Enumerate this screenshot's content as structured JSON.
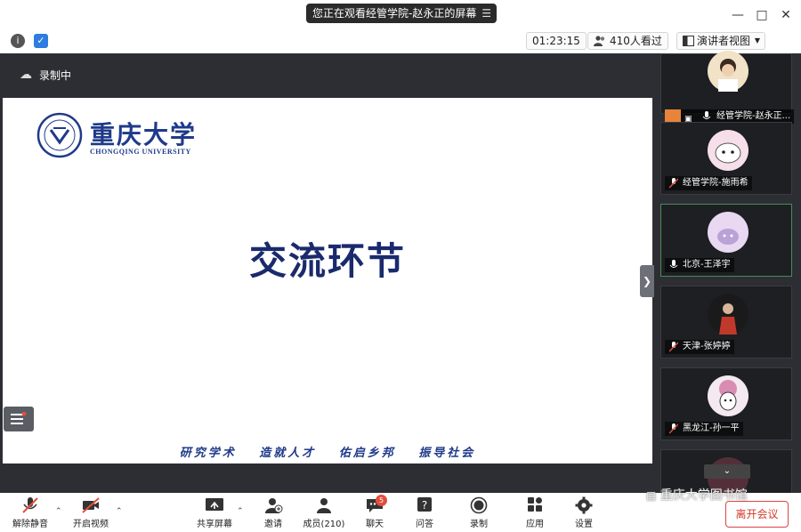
{
  "titlebar": {
    "banner_text": "您正在观看经管学院-赵永正的屏幕",
    "banner_menu": "☰"
  },
  "toolbar": {
    "timer": "01:23:15",
    "viewers": "410人看过",
    "view_mode": "演讲者视图"
  },
  "recording": {
    "label": "录制中"
  },
  "slide": {
    "logo_cn": "重庆大学",
    "logo_en": "CHONGQING UNIVERSITY",
    "title": "交流环节",
    "motto": "研究学术 造就人才 佑启乡邦 振导社会"
  },
  "participants": [
    {
      "name": "经管学院-赵永正...",
      "avatar_color": "#f1e2c8"
    },
    {
      "name": "经管学院-施雨希",
      "avatar_color": "#f6dfe8"
    },
    {
      "name": "北京-王泽宇",
      "avatar_color": "#e9d8f1"
    },
    {
      "name": "天津-张婷婷",
      "avatar_color": "#1a1a1a"
    },
    {
      "name": "黑龙江-孙一平",
      "avatar_color": "#f3e9ef"
    }
  ],
  "controls": {
    "unmute": "解除静音",
    "start_video": "开启视频",
    "share_screen": "共享屏幕",
    "invite": "邀请",
    "members": "成员(210)",
    "chat": "聊天",
    "chat_badge": "5",
    "qa": "问答",
    "record": "录制",
    "apps": "应用",
    "settings": "设置",
    "leave": "离开会议"
  },
  "watermark": "重庆大学图书馆",
  "colors": {
    "stage_bg": "#2c2e33",
    "slide_title": "#1a2a6c",
    "leave": "#d23a2a"
  }
}
